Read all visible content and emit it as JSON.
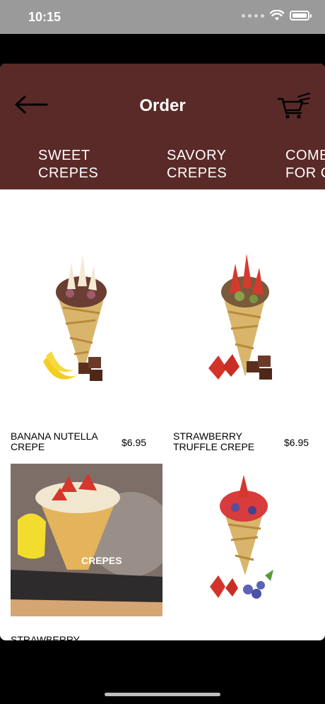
{
  "status_bar": {
    "time": "10:15"
  },
  "header": {
    "title": "Order"
  },
  "tabs": [
    {
      "label": "SWEET\nCREPES"
    },
    {
      "label": "SAVORY\nCREPES"
    },
    {
      "label": "COMB\nFOR C"
    }
  ],
  "products": [
    {
      "name": "BANANA NUTELLA CREPE",
      "price": "$6.95"
    },
    {
      "name": "STRAWBERRY TRUFFLE CREPE",
      "price": "$6.95"
    },
    {
      "name": "STRAWBERRY",
      "price": ""
    },
    {
      "name": "",
      "price": ""
    }
  ],
  "photo_sign": "CREPES",
  "colors": {
    "header_bg": "#5a2a28",
    "status_bar_bg": "#9a9a9a"
  }
}
